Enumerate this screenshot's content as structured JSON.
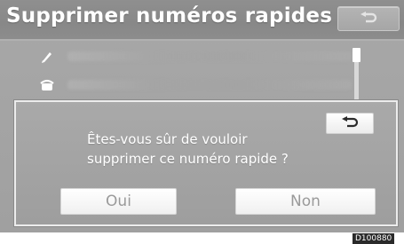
{
  "header": {
    "title": "Supprimer numéros rapides",
    "back_icon": "return-arrow-icon"
  },
  "list": {
    "rows": [
      {
        "icon": "pen-icon"
      },
      {
        "icon": "phone-icon"
      }
    ]
  },
  "dialog": {
    "message_line_1": "Êtes-vous sûr de vouloir",
    "message_line_2": "supprimer ce numéro rapide ?",
    "back_icon": "return-arrow-icon",
    "yes_label": "Oui",
    "no_label": "Non"
  },
  "reference_code": "D100880",
  "colors": {
    "screen_background": "#a4a4a4",
    "title_bar": "#8c8c8c",
    "dialog_border": "#ececec",
    "button_background": "#ffffff",
    "button_text": "#9a9a9a"
  }
}
